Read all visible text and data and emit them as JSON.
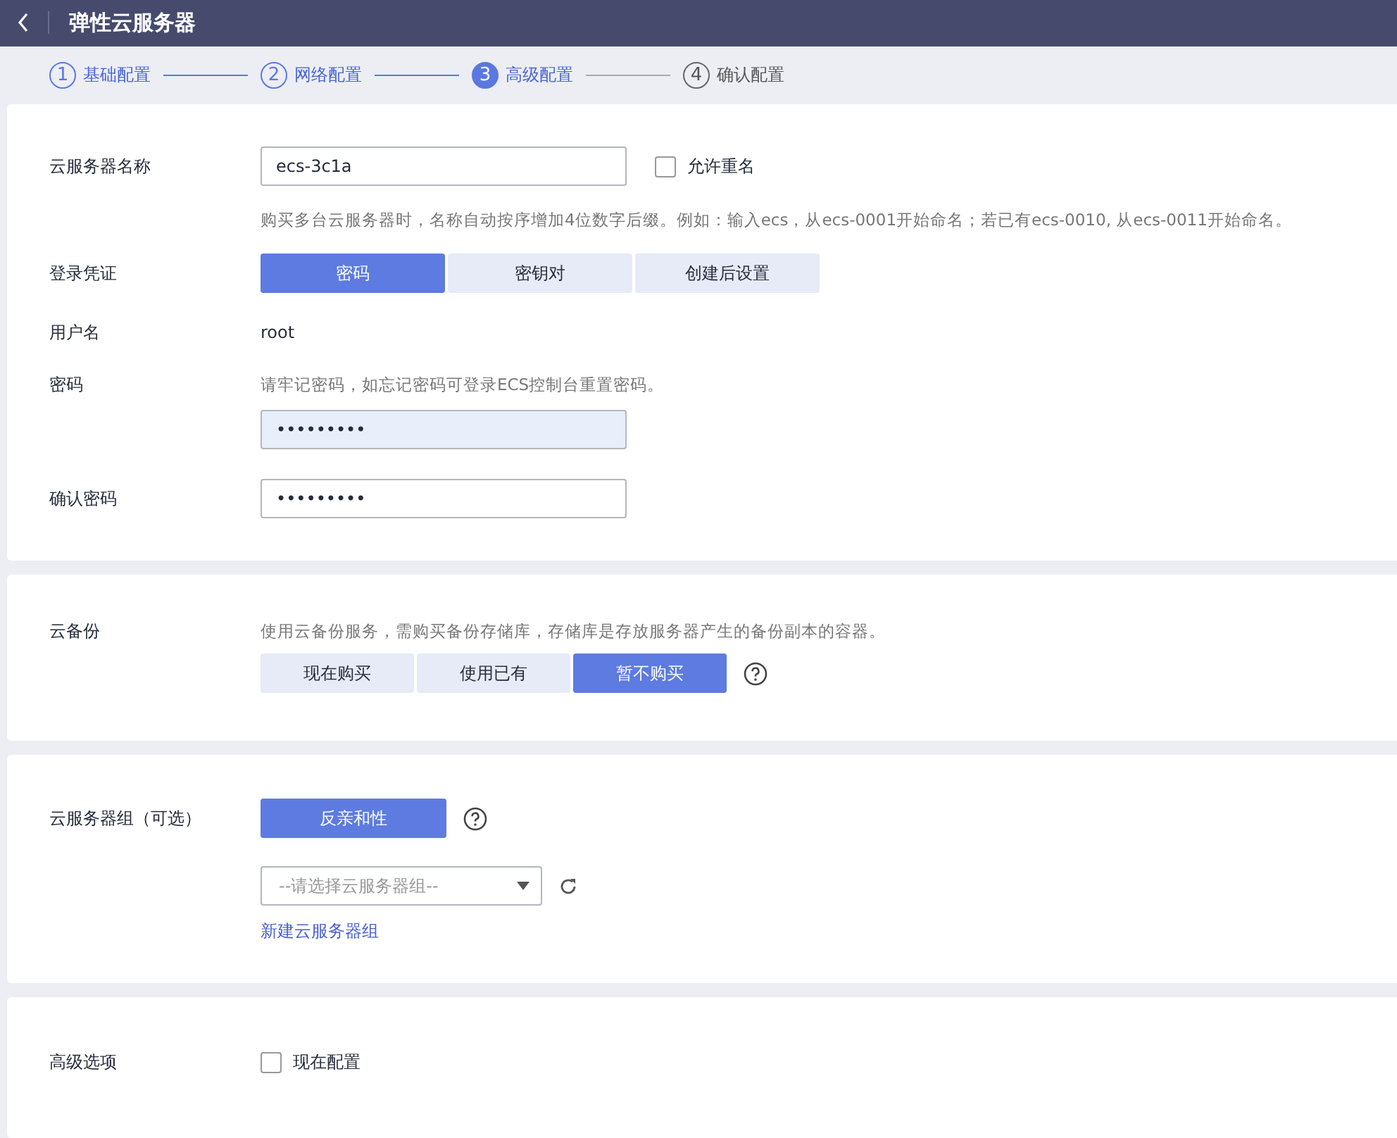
{
  "header": {
    "title": "弹性云服务器"
  },
  "steps": [
    {
      "number": "1",
      "label": "基础配置",
      "completed": true,
      "selected": false
    },
    {
      "number": "2",
      "label": "网络配置",
      "completed": true,
      "selected": false
    },
    {
      "number": "3",
      "label": "高级配置",
      "completed": false,
      "selected": true
    },
    {
      "number": "4",
      "label": "确认配置",
      "completed": false,
      "selected": false
    }
  ],
  "basic": {
    "name_label": "云服务器名称",
    "name_value": "ecs-3c1a",
    "allow_duplicate": {
      "label": "允许重名",
      "checked": false
    },
    "name_hint": "购买多台云服务器时，名称自动按序增加4位数字后缀。例如：输入ecs，从ecs-0001开始命名；若已有ecs-0010, 从ecs-0011开始命名。",
    "login_label": "登录凭证",
    "login_options": [
      {
        "label": "密码",
        "selected": true
      },
      {
        "label": "密钥对",
        "selected": false
      },
      {
        "label": "创建后设置",
        "selected": false
      }
    ],
    "user_label": "用户名",
    "user_value": "root",
    "password_label": "密码",
    "password_hint": "请牢记密码，如忘记密码可登录ECS控制台重置密码。",
    "password_value": "•••••••••",
    "password_focused": true,
    "confirm_label": "确认密码",
    "confirm_value": "•••••••••",
    "confirm_focused": false
  },
  "backup": {
    "label": "云备份",
    "hint": "使用云备份服务，需购买备份存储库，存储库是存放服务器产生的备份副本的容器。",
    "options": [
      {
        "label": "现在购买",
        "selected": false
      },
      {
        "label": "使用已有",
        "selected": false
      },
      {
        "label": "暂不购买",
        "selected": true
      }
    ]
  },
  "group": {
    "label": "云服务器组（可选）",
    "policy_button": "反亲和性",
    "select_placeholder": "--请选择云服务器组--",
    "create_link": "新建云服务器组"
  },
  "advanced": {
    "label": "高级选项",
    "option": {
      "label": "现在配置",
      "checked": false
    }
  }
}
